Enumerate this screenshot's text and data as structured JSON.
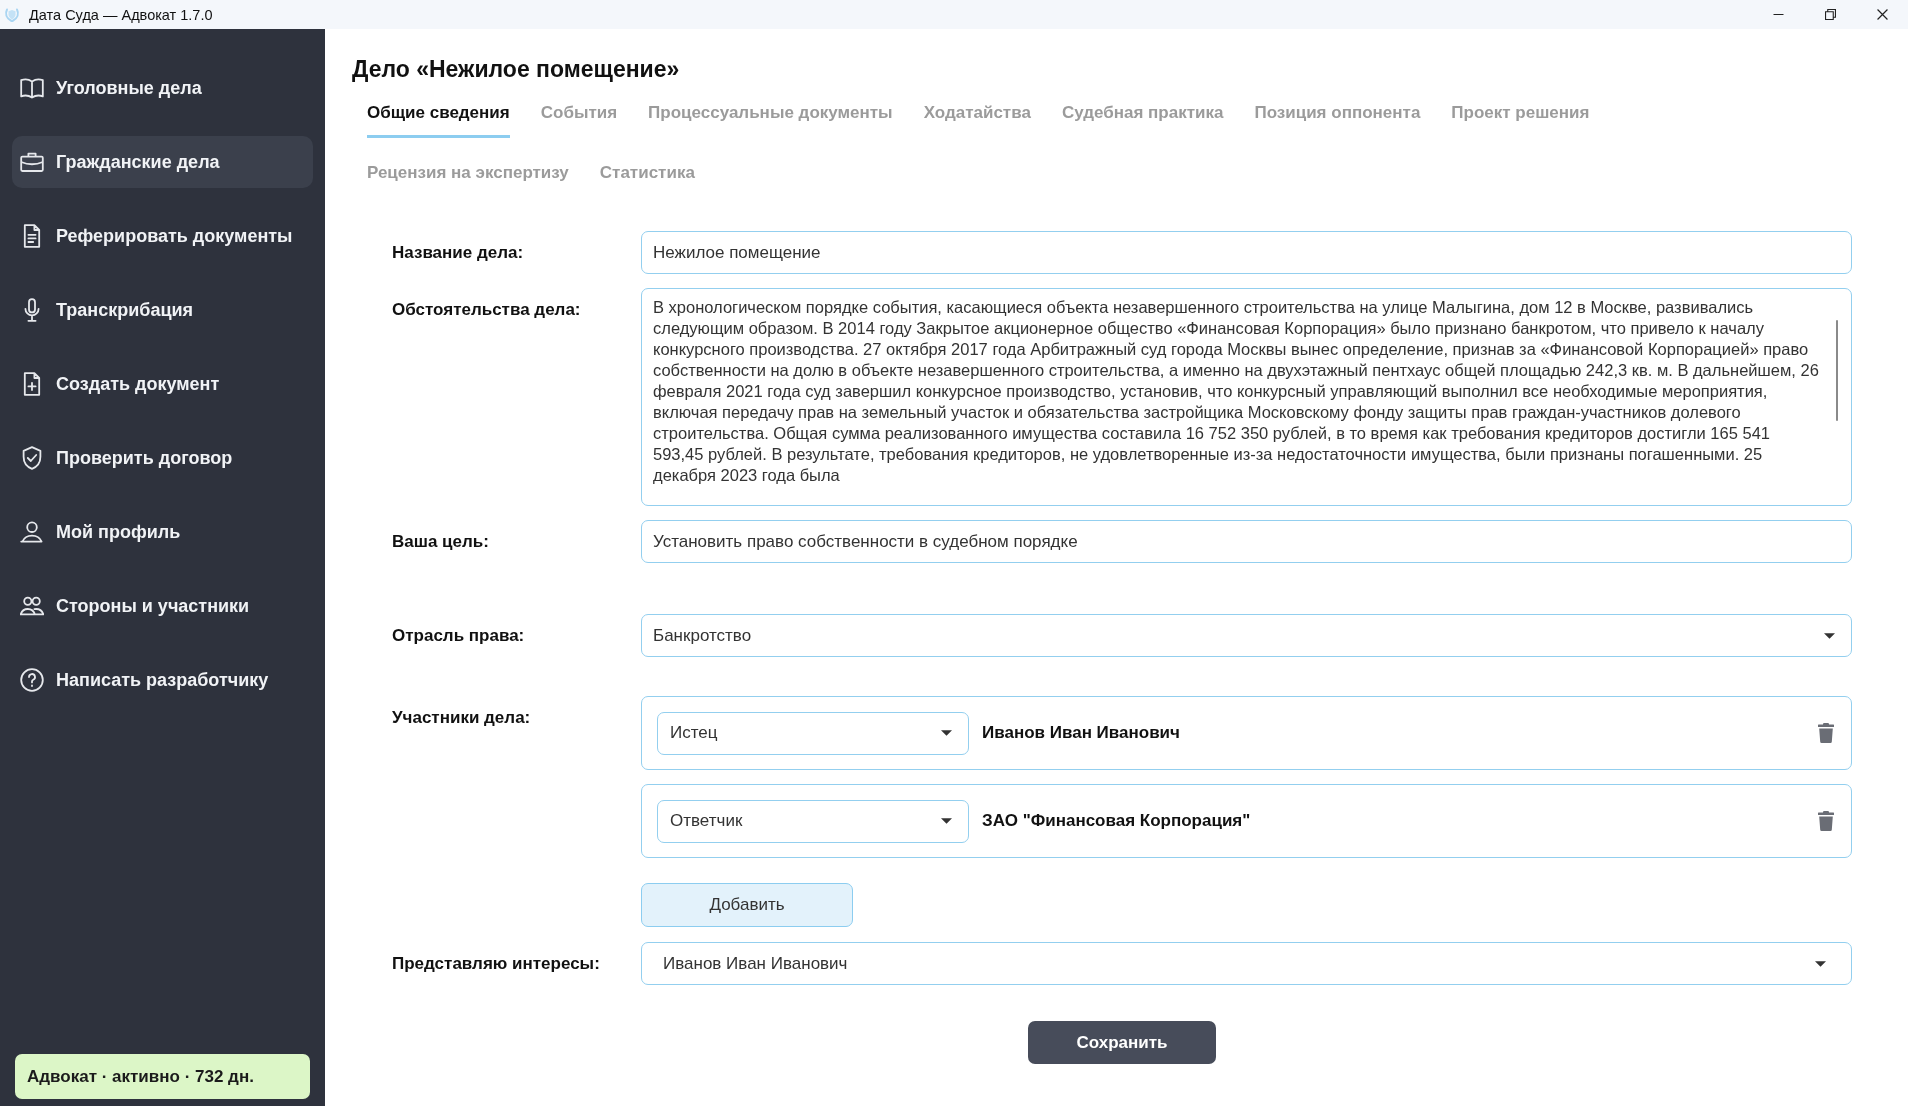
{
  "window": {
    "title": "Дата Суда — Адвокат 1.7.0"
  },
  "sidebar": {
    "items": [
      {
        "label": "Уголовные дела",
        "selected": false
      },
      {
        "label": "Гражданские дела",
        "selected": true
      },
      {
        "label": "Реферировать документы",
        "selected": false
      },
      {
        "label": "Транскрибация",
        "selected": false
      },
      {
        "label": "Создать документ",
        "selected": false
      },
      {
        "label": "Проверить договор",
        "selected": false
      },
      {
        "label": "Мой профиль",
        "selected": false
      },
      {
        "label": "Стороны и участники",
        "selected": false
      },
      {
        "label": "Написать разработчику",
        "selected": false
      }
    ],
    "license_badge": "Адвокат · активно · 732 дн."
  },
  "page_title": "Дело «Нежилое помещение»",
  "tabs": [
    {
      "label": "Общие сведения",
      "selected": true
    },
    {
      "label": "События",
      "selected": false
    },
    {
      "label": "Процессуальные документы",
      "selected": false
    },
    {
      "label": "Ходатайства",
      "selected": false
    },
    {
      "label": "Судебная практика",
      "selected": false
    },
    {
      "label": "Позиция оппонента",
      "selected": false
    },
    {
      "label": "Проект решения",
      "selected": false
    },
    {
      "label": "Рецензия на экспертизу",
      "selected": false
    },
    {
      "label": "Статистика",
      "selected": false
    }
  ],
  "form": {
    "case_name": {
      "label": "Название дела:",
      "value": "Нежилое помещение"
    },
    "circumstances": {
      "label": "Обстоятельства дела:",
      "value": "В хронологическом порядке события, касающиеся объекта незавершенного строительства на улице Малыгина, дом 12 в Москве, развивались следующим образом. В 2014 году Закрытое акционерное общество «Финансовая Корпорация» было признано банкротом, что привело к началу конкурсного производства. 27 октября 2017 года Арбитражный суд города Москвы вынес определение, признав за «Финансовой Корпорацией» право собственности на долю в объекте незавершенного строительства, а именно на двухэтажный пентхаус общей площадью 242,3 кв. м. В дальнейшем, 26 февраля 2021 года суд завершил конкурсное производство, установив, что конкурсный управляющий выполнил все необходимые мероприятия, включая передачу прав на земельный участок и обязательства застройщика Московскому фонду защиты прав граждан-участников долевого строительства. Общая сумма реализованного имущества составила 16 752 350 рублей, в то время как требования кредиторов достигли 165 541 593,45 рублей. В результате, требования кредиторов, не удовлетворенные из-за недостаточности имущества, были признаны погашенными. 25 декабря 2023 года была"
    },
    "goal": {
      "label": "Ваша цель:",
      "value": "Установить право собственности в судебном порядке"
    },
    "branch": {
      "label": "Отрасль права:",
      "value": "Банкротство"
    },
    "participants": {
      "label": "Участники дела:",
      "items": [
        {
          "role": "Истец",
          "name": "Иванов Иван Иванович"
        },
        {
          "role": "Ответчик",
          "name": "ЗАО \"Финансовая Корпорация\""
        }
      ],
      "add_button": "Добавить"
    },
    "represent": {
      "label": "Представляю интересы:",
      "value": "Иванов Иван Иванович"
    },
    "save_button": "Сохранить"
  }
}
